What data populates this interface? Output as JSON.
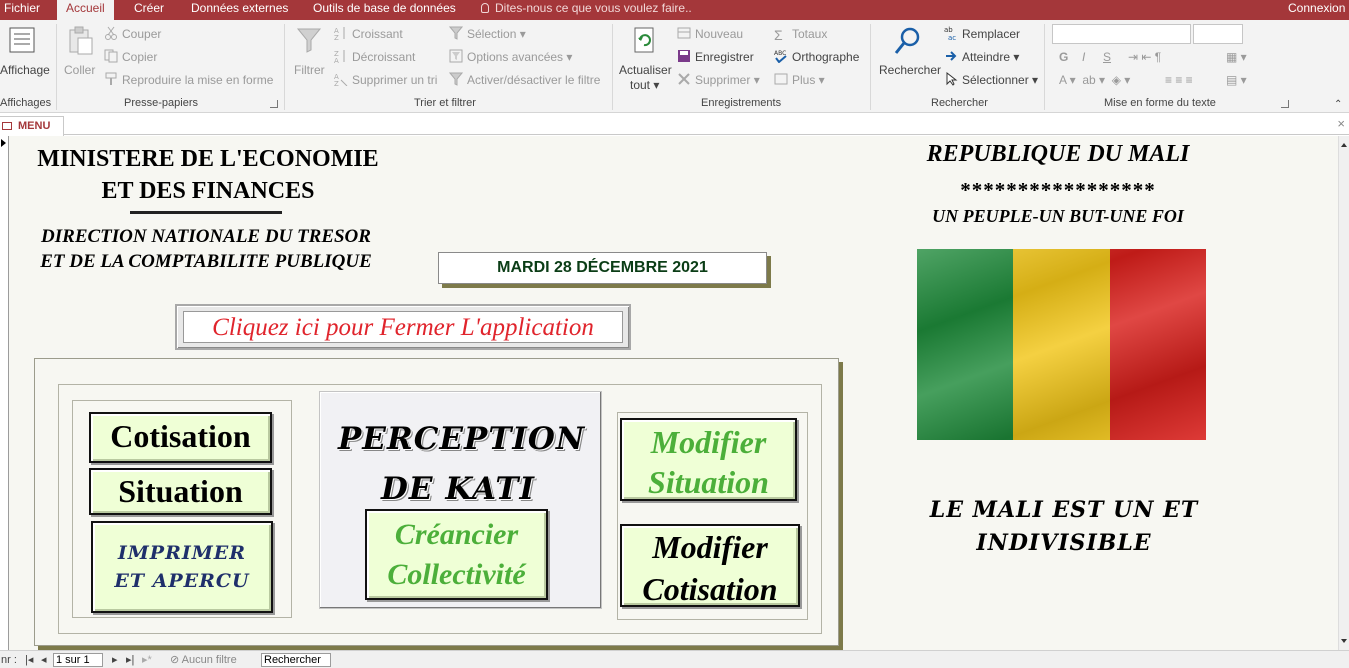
{
  "menu": {
    "file": "Fichier",
    "home": "Accueil",
    "create": "Créer",
    "external": "Données externes",
    "db_tools": "Outils de base de données",
    "tell_me": "Dites-nous ce que vous voulez faire..",
    "sign_in": "Connexion"
  },
  "ribbon": {
    "views": {
      "view": "Affichage",
      "group": "Affichages"
    },
    "clipboard": {
      "paste": "Coller",
      "cut": "Couper",
      "copy": "Copier",
      "format_painter": "Reproduire la mise en forme",
      "group": "Presse-papiers"
    },
    "sort": {
      "filter": "Filtrer",
      "ascending": "Croissant",
      "descending": "Décroissant",
      "remove_sort": "Supprimer un tri",
      "selection": "Sélection",
      "advanced": "Options avancées",
      "toggle_filter": "Activer/désactiver le filtre",
      "group": "Trier et filtrer"
    },
    "records": {
      "refresh_line1": "Actualiser",
      "refresh_line2": "tout",
      "new": "Nouveau",
      "save": "Enregistrer",
      "delete": "Supprimer",
      "totals": "Totaux",
      "spelling": "Orthographe",
      "more": "Plus",
      "group": "Enregistrements"
    },
    "find": {
      "find": "Rechercher",
      "replace": "Remplacer",
      "goto": "Atteindre",
      "select": "Sélectionner",
      "group": "Rechercher"
    },
    "text_format": {
      "group": "Mise en forme du texte",
      "bold": "G",
      "italic": "I",
      "underline": "S"
    }
  },
  "doc_tab": {
    "label": "MENU"
  },
  "form": {
    "ministry_line1": "MINISTERE DE L'ECONOMIE",
    "ministry_line2": "ET DES FINANCES",
    "direction_line1": "DIRECTION NATIONALE DU TRESOR",
    "direction_line2": "ET DE LA COMPTABILITE PUBLIQUE",
    "date": "MARDI 28 DÉCEMBRE 2021",
    "close_app": "Cliquez ici pour Fermer L'application",
    "buttons": {
      "cotisation": "Cotisation",
      "situation": "Situation",
      "print_line1": "IMPRIMER",
      "print_line2": "ET APERCU",
      "creancier_line1": "Créancier",
      "creancier_line2": "Collectivité",
      "mod_situation_line1": "Modifier",
      "mod_situation_line2": "Situation",
      "mod_cotisation_line1": "Modifier",
      "mod_cotisation_line2": "Cotisation"
    },
    "perception_line1": "PERCEPTION",
    "perception_line2": "DE KATI",
    "republique": "REPUBLIQUE DU MALI",
    "stars": "*****************",
    "devise": "UN PEUPLE-UN BUT-UNE FOI",
    "motto_line1": "LE MALI EST UN ET",
    "motto_line2": "INDIVISIBLE",
    "flag_colors": [
      "#1e8a3a",
      "#f2c618",
      "#d91f1b"
    ]
  },
  "navbar": {
    "prefix": "nr :",
    "record": "1 sur 1",
    "no_filter": "Aucun filtre",
    "search": "Rechercher"
  }
}
